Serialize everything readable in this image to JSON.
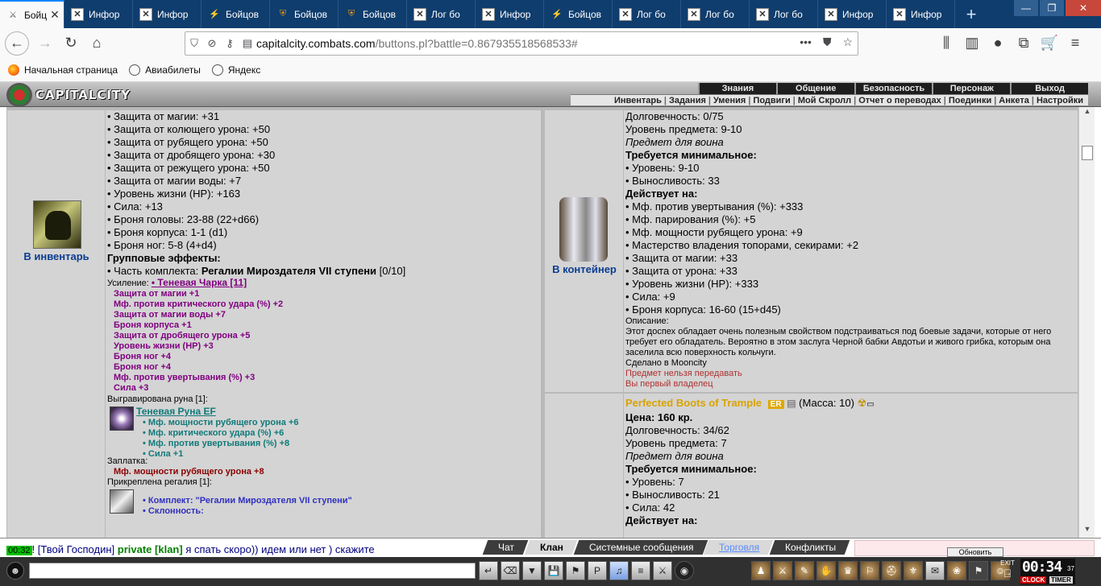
{
  "browser": {
    "tabs": [
      {
        "label": "Бойц",
        "icon": "crossed-swords-icon",
        "active": true
      },
      {
        "label": "Инфор",
        "icon": "broken-image-icon"
      },
      {
        "label": "Инфор",
        "icon": "broken-image-icon"
      },
      {
        "label": "Бойцов",
        "icon": "flame-icon"
      },
      {
        "label": "Бойцов",
        "icon": "shield-icon"
      },
      {
        "label": "Бойцов",
        "icon": "shield-icon"
      },
      {
        "label": "Лог бо",
        "icon": "broken-image-icon"
      },
      {
        "label": "Инфор",
        "icon": "broken-image-icon"
      },
      {
        "label": "Бойцов",
        "icon": "flame-icon"
      },
      {
        "label": "Лог бо",
        "icon": "broken-image-icon"
      },
      {
        "label": "Лог бо",
        "icon": "broken-image-icon"
      },
      {
        "label": "Лог бо",
        "icon": "broken-image-icon"
      },
      {
        "label": "Инфор",
        "icon": "broken-image-icon"
      },
      {
        "label": "Инфор",
        "icon": "broken-image-icon"
      }
    ],
    "url_host": "capitalcity.combats.com",
    "url_path": "/buttons.pl?battle=0.867935518568533#",
    "bookmarks": [
      "Начальная страница",
      "Авиабилеты",
      "Яндекс"
    ]
  },
  "game": {
    "logo": "CAPITALCITY",
    "menu_top": [
      "Знания",
      "Общение",
      "Безопасность",
      "Персонаж",
      "Выход"
    ],
    "menu_bottom": [
      "Инвентарь",
      "Задания",
      "Умения",
      "Подвиги",
      "Мой Скролл",
      "Отчет о переводах",
      "Поединки",
      "Анкета",
      "Настройки"
    ]
  },
  "left_item": {
    "action": "В инвентарь",
    "lines": [
      "• Защита от магии: +31",
      "• Защита от колющего урона: +50",
      "• Защита от рубящего урона: +50",
      "• Защита от дробящего урона: +30",
      "• Защита от режущего урона: +50",
      "• Защита от магии воды: +7",
      "• Уровень жизни (HP): +163",
      "• Сила: +13",
      "• Броня головы: 23-88 (22+d66)",
      "• Броня корпуса: 1-1 (d1)",
      "• Броня ног: 5-8 (4+d4)"
    ],
    "group_effects": "Групповые эффекты:",
    "set_prefix": "• Часть комплекта: ",
    "set_name": "Регалии Мироздателя VII ступени",
    "set_count": " [0/10]",
    "boost_label": "Усиление: ",
    "boost_name": "• Теневая Чарка [11]",
    "boost_lines": [
      "Защита от магии +1",
      "Мф. против критического удара (%) +2",
      "Защита от магии воды +7",
      "Броня корпуса +1",
      "Защита от дробящего урона +5",
      "Уровень жизни (HP) +3",
      "Броня ног +4",
      "Броня ног +4",
      "Мф. против увертывания (%) +3",
      "Сила +3"
    ],
    "rune_label": "Выгравирована руна [1]:",
    "rune_name": "Теневая Руна EF",
    "rune_lines": [
      "• Мф. мощности рубящего урона +6",
      "• Мф. критического удара (%) +6",
      "• Мф. против увертывания (%) +8",
      "• Сила +1"
    ],
    "patch_label": "Заплатка:",
    "patch_line": "Мф. мощности рубящего урона +8",
    "regalia_label": "Прикреплена регалия [1]:",
    "regalia_lines": [
      "• Комплект: \"Регалии Мироздателя VII ступени\"",
      "• Склонность:"
    ]
  },
  "right_item_1": {
    "action": "В контейнер",
    "durability": "Долговечность: 0/75",
    "level": "Уровень предмета: 9-10",
    "for": "Предмет для воина",
    "req_title": "Требуется минимальное:",
    "req_lines": [
      "• Уровень: 9-10",
      "• Выносливость: 33"
    ],
    "acts_title": "Действует на:",
    "acts_lines": [
      "• Мф. против увертывания (%): +333",
      "• Мф. парирования (%): +5",
      "• Мф. мощности рубящего урона: +9",
      "• Мастерство владения топорами, секирами: +2",
      "• Защита от магии: +33",
      "• Защита от урона: +33",
      "• Уровень жизни (HP): +333",
      "• Сила: +9",
      "• Броня корпуса: 16-60 (15+d45)"
    ],
    "desc_label": "Описание:",
    "desc": "Этот доспех обладает очень полезным свойством подстраиваться под боевые задачи, которые от него требует его обладатель. Вероятно в этом заслуга Черной бабки Авдотьи и живого грибка, которым она заселила всю поверхность кольчуги.",
    "made_in": "Сделано в Mooncity",
    "no_transfer": "Предмет нельзя передавать",
    "first_owner": "Вы первый владелец"
  },
  "right_item_2": {
    "name": "Perfected Boots of Trample",
    "badge": "ER",
    "mass": "(Масса: 10)",
    "price": "Цена: 160 кр.",
    "durability": "Долговечность: 34/62",
    "level": "Уровень предмета: 7",
    "for": "Предмет для воина",
    "req_title": "Требуется минимальное:",
    "req_lines": [
      "• Уровень: 7",
      "• Выносливость: 21",
      "• Сила: 42"
    ],
    "acts_title": "Действует на:"
  },
  "chat": {
    "time": "00:32",
    "sender": "[Твой Господин]",
    "mode": "private",
    "target": "[klan]",
    "message": "я спать скоро)) идем или нет ) скажите",
    "tabs": [
      "Чат",
      "Клан",
      "Системные сообщения",
      "Торговля",
      "Конфликты"
    ],
    "refresh": "Обновить"
  },
  "toolbar": {
    "clock": "00:34",
    "seconds": "37",
    "clock_label": "CLOCK",
    "timer_label": "TIMER",
    "exit_label": "EXIT"
  }
}
